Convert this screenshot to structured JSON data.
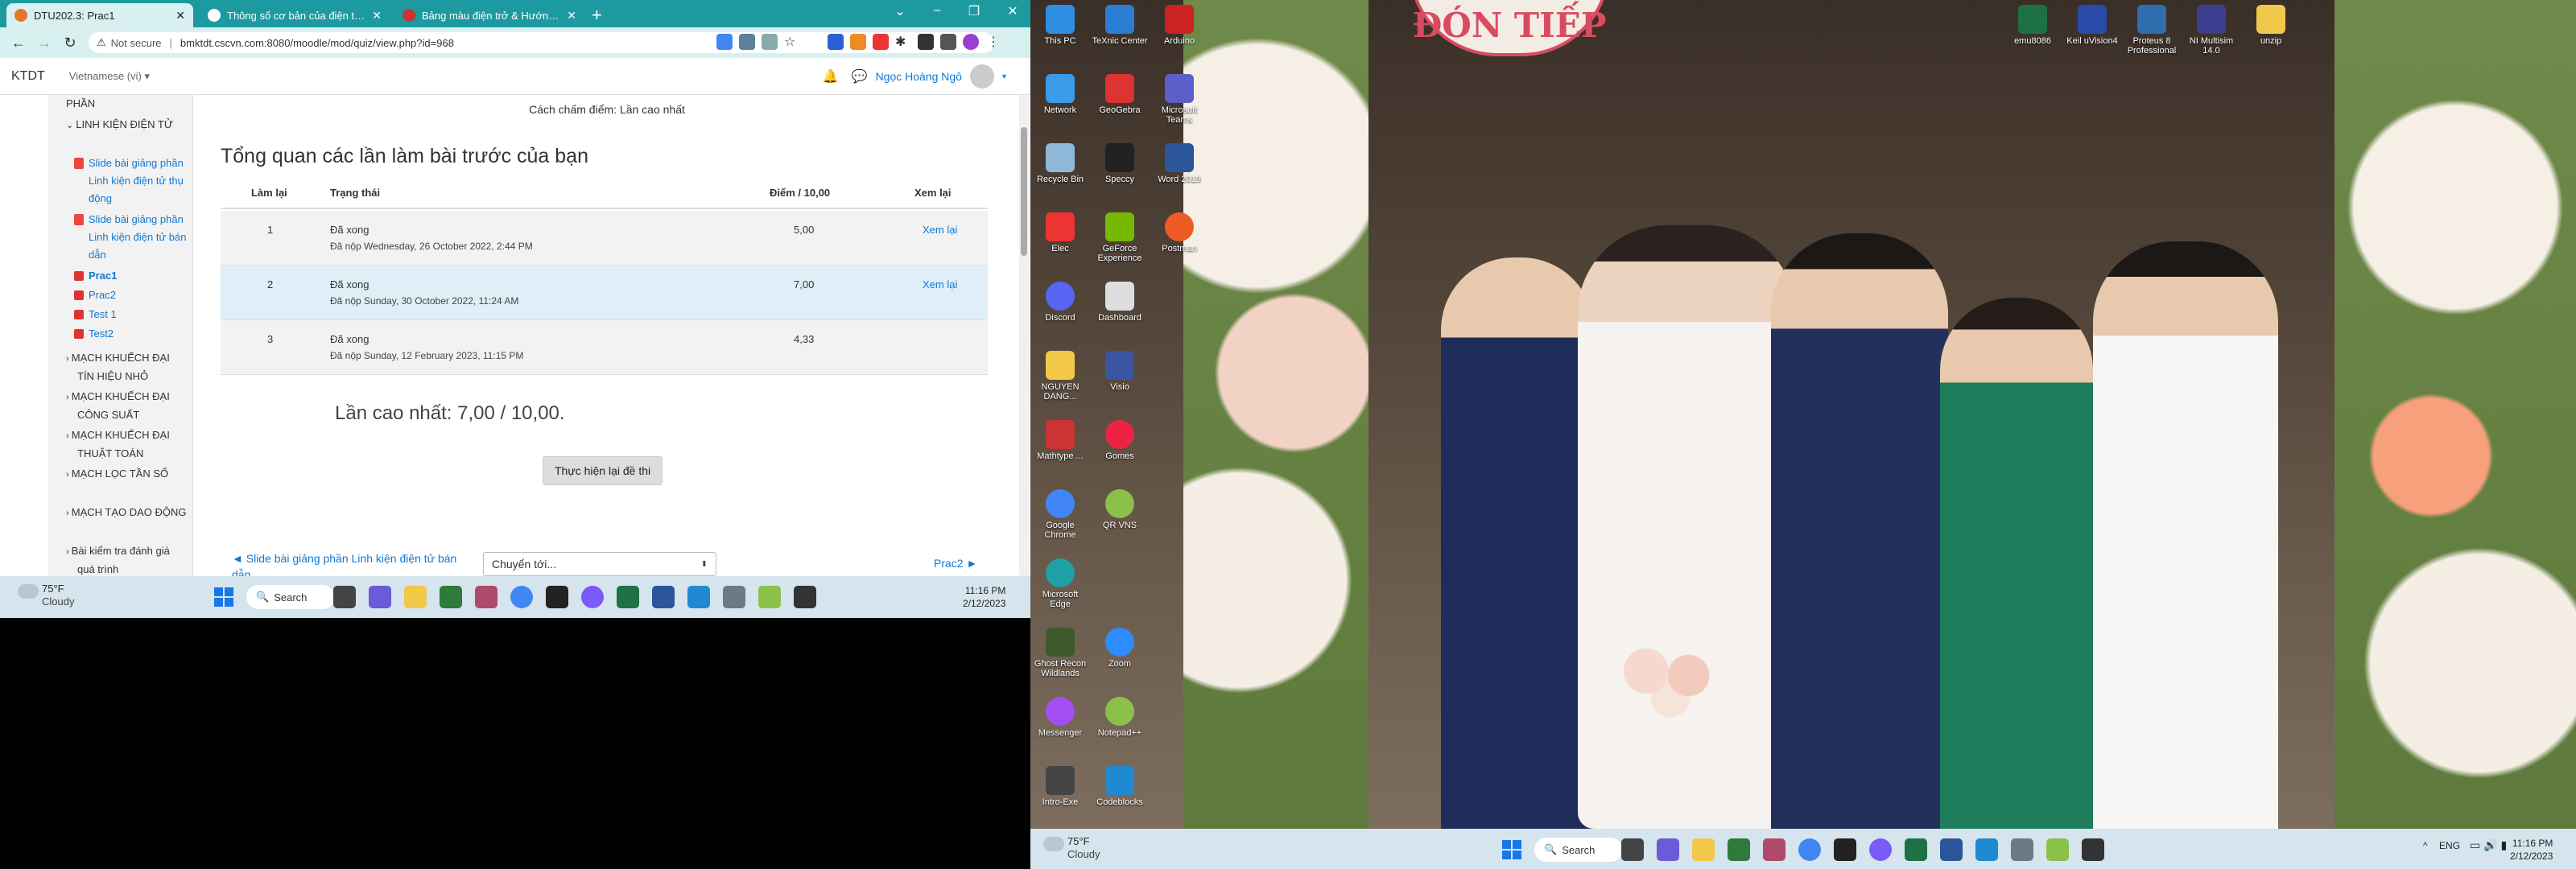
{
  "browser": {
    "tabs": [
      {
        "title": "DTU202.3: Prac1",
        "active": true
      },
      {
        "title": "Thông số cơ bản của điện trở là",
        "active": false
      },
      {
        "title": "Bảng màu điện trở & Hướng dẫ",
        "active": false
      }
    ],
    "address": {
      "security": "Not secure",
      "url": "bmktdt.cscvn.com:8080/moodle/mod/quiz/view.php?id=968"
    }
  },
  "moodle": {
    "brand": "KTDT",
    "language": "Vietnamese (vi)",
    "user_name": "Ngọc Hoàng Ngô"
  },
  "sidebar": {
    "items": [
      {
        "type": "text",
        "label": "PHẦN"
      },
      {
        "type": "section",
        "label": "LINH KIỆN ĐIỆN TỬ"
      },
      {
        "type": "link",
        "label": "Slide bài giảng phần Linh kiện điện tử thụ động"
      },
      {
        "type": "link",
        "label": "Slide bài giảng phần Linh kiện điện tử bán dẫn"
      },
      {
        "type": "quiz",
        "label": "Prac1"
      },
      {
        "type": "quiz",
        "label": "Prac2"
      },
      {
        "type": "quiz",
        "label": "Test 1"
      },
      {
        "type": "quiz",
        "label": "Test2"
      },
      {
        "type": "section",
        "label": "MẠCH KHUẾCH ĐẠI TÍN HIỆU NHỎ"
      },
      {
        "type": "section",
        "label": "MẠCH KHUẾCH ĐẠI CÔNG SUẤT"
      },
      {
        "type": "section",
        "label": "MẠCH KHUẾCH ĐẠI THUẬT TOÁN"
      },
      {
        "type": "section",
        "label": "MẠCH LỌC TẦN SỐ"
      },
      {
        "type": "section",
        "label": "MẠCH TẠO DAO ĐỘNG"
      },
      {
        "type": "section",
        "label": "Bài kiểm tra đánh giá quá trình"
      }
    ]
  },
  "main": {
    "grading_method": "Cách chấm điểm: Lần cao nhất",
    "summary_title": "Tổng quan các lần làm bài trước của bạn",
    "columns": [
      "Làm lại",
      "Trạng thái",
      "Điểm / 10,00",
      "Xem lại"
    ],
    "attempts": [
      {
        "num": "1",
        "status": "Đã xong",
        "submitted": "Đã nộp Wednesday, 26 October 2022, 2:44 PM",
        "grade": "5,00",
        "review": "Xem lại"
      },
      {
        "num": "2",
        "status": "Đã xong",
        "submitted": "Đã nộp Sunday, 30 October 2022, 11:24 AM",
        "grade": "7,00",
        "review": "Xem lại"
      },
      {
        "num": "3",
        "status": "Đã xong",
        "submitted": "Đã nộp Sunday, 12 February 2023, 11:15 PM",
        "grade": "4,33",
        "review": ""
      }
    ],
    "highest_grade": "Lần cao nhất: 7,00 / 10,00.",
    "reattempt_button": "Thực hiện lại đề thi",
    "nav_prev": "◄ Slide bài giảng phần Linh kiện điện tử bán dẫn",
    "jump_to": "Chuyển tới...",
    "nav_next": "Prac2 ►"
  },
  "taskbar_left": {
    "weather_temp": "75°F",
    "weather_desc": "Cloudy",
    "search_label": "Search",
    "time": "11:16 PM",
    "date": "2/12/2023"
  },
  "desktop": {
    "icons_col1": [
      "This PC",
      "Network",
      "Recycle Bin",
      "Elec",
      "Discord",
      "NGUYEN DANG...",
      "Mathtype ...",
      "Google Chrome",
      "Microsoft Edge",
      "Ghost Recon Wildlands",
      "Messenger",
      "Intro-Exe"
    ],
    "icons_col2": [
      "TeXnic Center",
      "GeoGebra",
      "Speccy",
      "GeForce Experience",
      "Dashboard",
      "Visio",
      "Gomes",
      "QR VNS",
      "Zoom",
      "Notepad++",
      "Codeblocks"
    ],
    "icons_col3": [
      "Arduino",
      "Microsoft Teams",
      "Word 2019",
      "Postman"
    ],
    "icons_top_right": [
      "emu8086",
      "Keil uVision4",
      "Proteus 8 Professional",
      "NI Multisim 14.0",
      "unzip"
    ],
    "sign_text": "ĐÓN TIẾP"
  },
  "taskbar_right": {
    "weather_temp": "75°F",
    "weather_desc": "Cloudy",
    "search_label": "Search",
    "lang": "ENG",
    "time": "11:16 PM",
    "date": "2/12/2023"
  }
}
